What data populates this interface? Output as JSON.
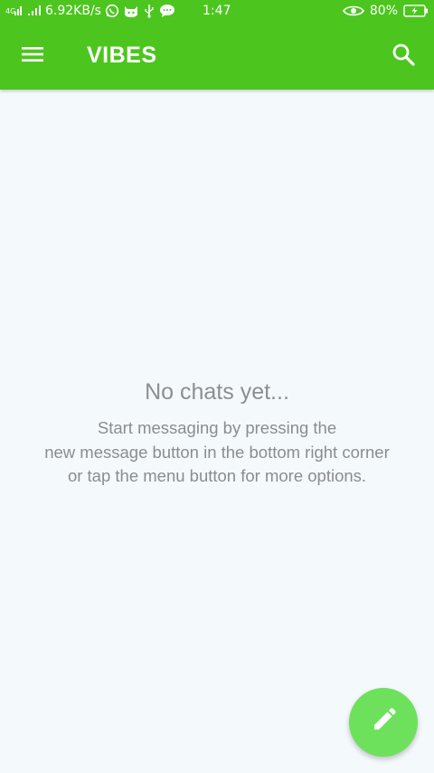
{
  "status_bar": {
    "speed": "6.92KB/s",
    "time": "1:47",
    "battery": "80%",
    "icons_left": [
      "sim-signal-icon",
      "signal-icon",
      "whatsapp-icon",
      "cat-app-icon",
      "usb-icon",
      "message-bubble-icon"
    ],
    "icons_right": [
      "eye-icon",
      "battery-charging-icon"
    ]
  },
  "app_bar": {
    "title": "VIBES",
    "menu_icon": "hamburger-menu-icon",
    "search_icon": "search-icon",
    "color": "#4cc61e"
  },
  "empty_state": {
    "title": "No chats yet...",
    "line1": "Start messaging by pressing the",
    "line2": "new message button in the bottom right corner",
    "line3": "or tap the menu button for more options."
  },
  "fab": {
    "icon": "pencil-icon",
    "color": "#6ee15c"
  },
  "colors": {
    "background": "#f4f9fc",
    "text_muted": "#8a8d90"
  }
}
